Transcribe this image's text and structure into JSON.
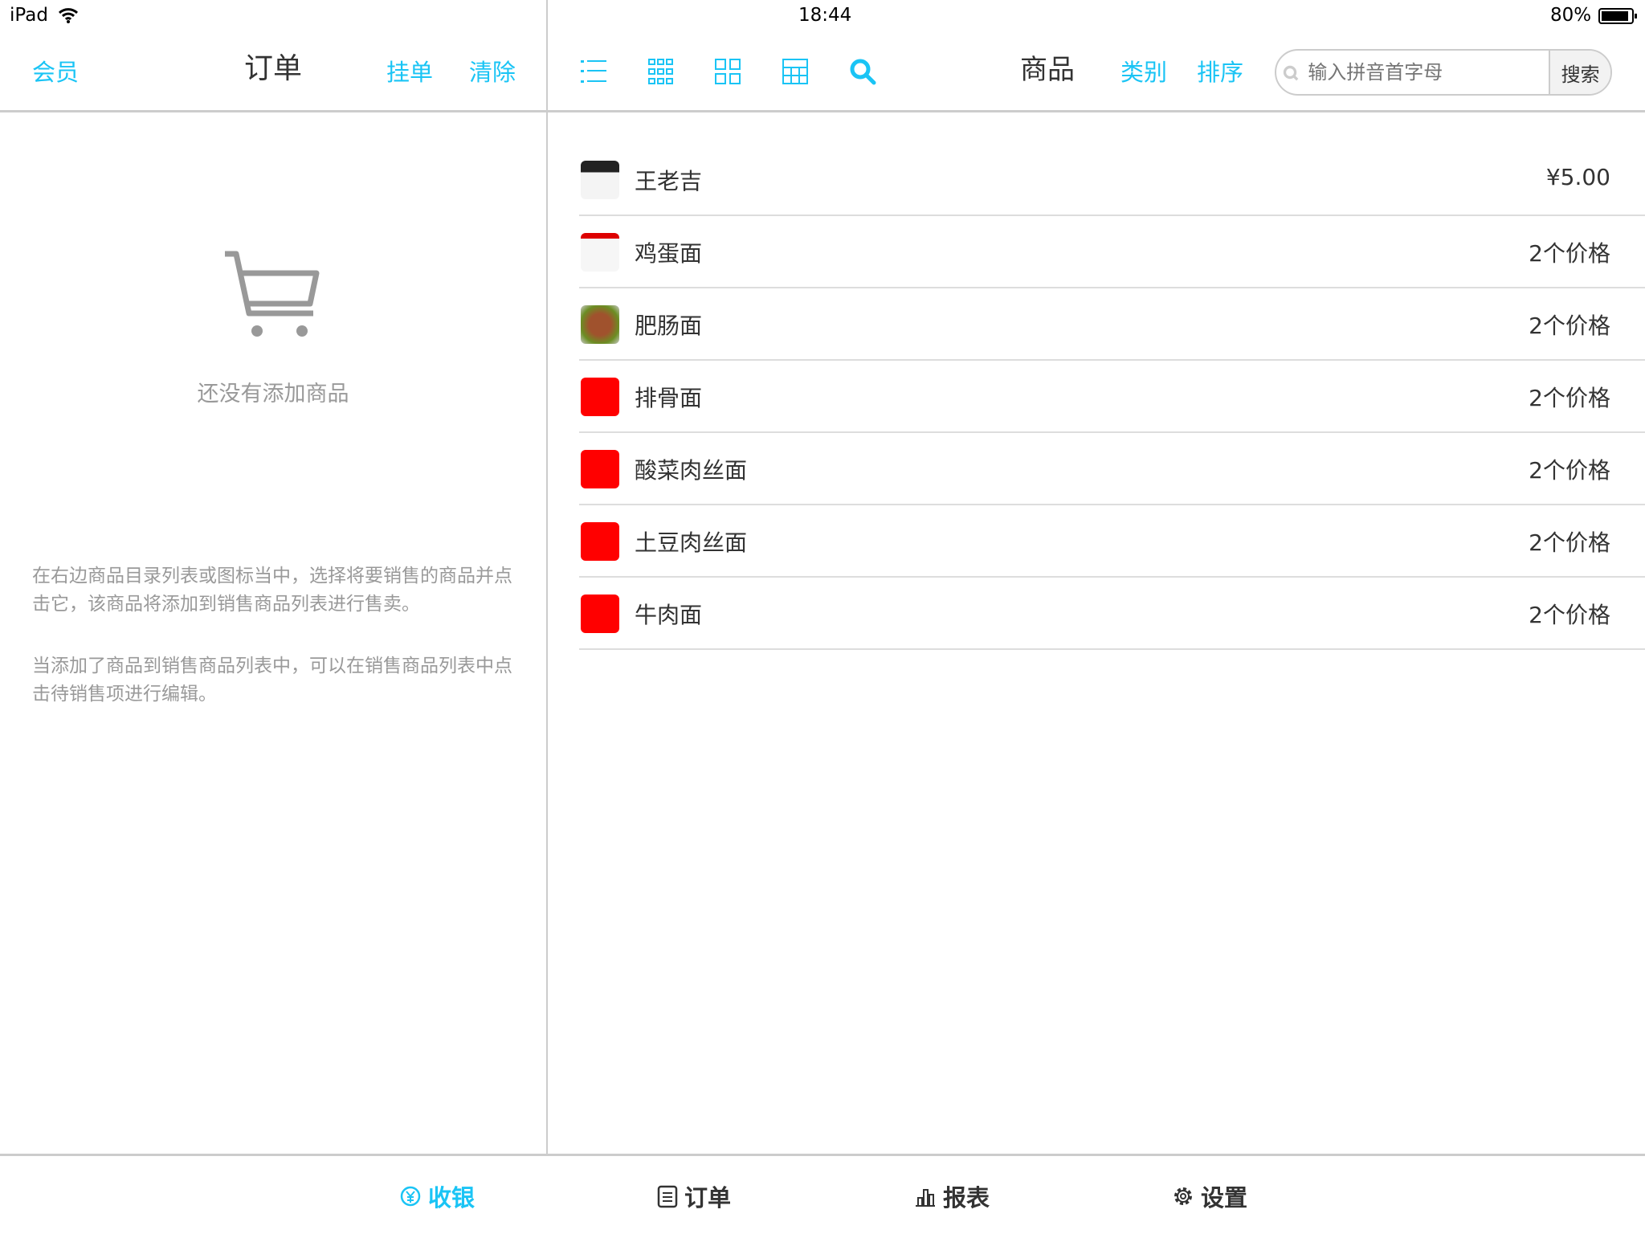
{
  "status": {
    "device": "iPad",
    "time": "18:44",
    "battery": "80%"
  },
  "order_panel": {
    "member": "会员",
    "title": "订单",
    "hold": "挂单",
    "clear": "清除",
    "empty_text": "还没有添加商品",
    "help1": "在右边商品目录列表或图标当中，选择将要销售的商品并点击它，该商品将添加到销售商品列表进行售卖。",
    "help2": "当添加了商品到销售商品列表中，可以在销售商品列表中点击待销售项进行编辑。"
  },
  "product_panel": {
    "title": "商品",
    "category": "类别",
    "sort": "排序",
    "search_placeholder": "输入拼音首字母",
    "search_button": "搜索",
    "view_icons": [
      "list-view-icon",
      "small-grid-icon",
      "large-grid-icon",
      "table-view-icon",
      "search-icon"
    ],
    "items": [
      {
        "name": "王老吉",
        "price": "¥5.00",
        "thumb": "image"
      },
      {
        "name": "鸡蛋面",
        "price": "2个价格",
        "thumb": "image"
      },
      {
        "name": "肥肠面",
        "price": "2个价格",
        "thumb": "food"
      },
      {
        "name": "排骨面",
        "price": "2个价格",
        "thumb": "red"
      },
      {
        "name": "酸菜肉丝面",
        "price": "2个价格",
        "thumb": "red"
      },
      {
        "name": "土豆肉丝面",
        "price": "2个价格",
        "thumb": "red"
      },
      {
        "name": "牛肉面",
        "price": "2个价格",
        "thumb": "red"
      }
    ]
  },
  "tabbar": [
    {
      "label": "收银",
      "icon": "yen-circle-icon",
      "active": true
    },
    {
      "label": "订单",
      "icon": "clipboard-icon"
    },
    {
      "label": "报表",
      "icon": "bar-chart-icon"
    },
    {
      "label": "设置",
      "icon": "gear-icon"
    }
  ],
  "colors": {
    "accent": "#1ac4f5",
    "thumb_red": "#ff0000"
  }
}
